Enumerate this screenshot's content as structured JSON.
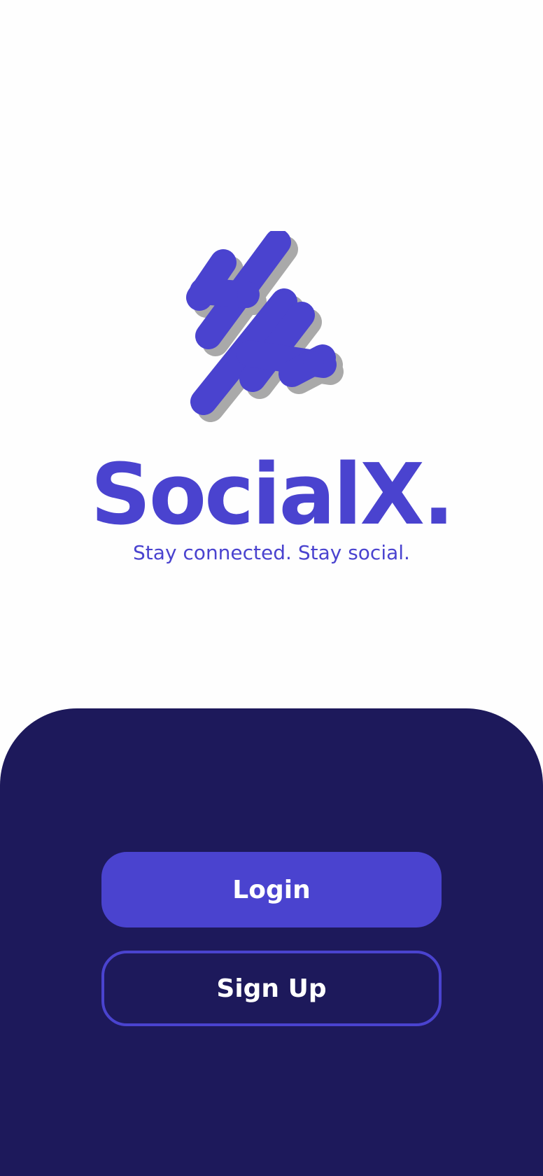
{
  "brand": {
    "name": "SocialX.",
    "tagline": "Stay connected. Stay social.",
    "logo_icon": "socialx-logo-icon"
  },
  "actions": {
    "login_label": "Login",
    "signup_label": "Sign Up"
  },
  "colors": {
    "primary": "#4a43cf",
    "panel": "#1d195b",
    "background": "#fefefe",
    "logo_shadow": "#a9a9a9",
    "button_text": "#ffffff"
  }
}
